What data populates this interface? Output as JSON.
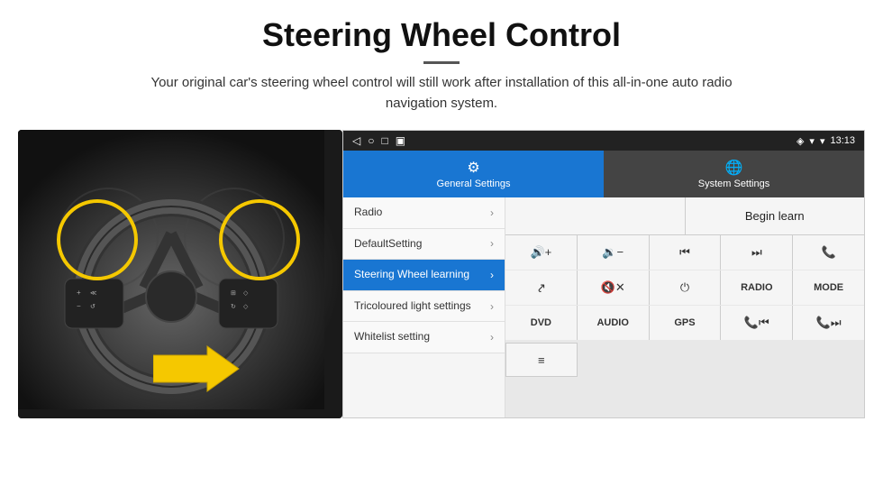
{
  "header": {
    "title": "Steering Wheel Control",
    "subtitle": "Your original car's steering wheel control will still work after installation of this all-in-one auto radio navigation system."
  },
  "status_bar": {
    "icons_left": [
      "◁",
      "○",
      "□",
      "▣"
    ],
    "signal": "▾",
    "wifi": "▾",
    "time": "13:13"
  },
  "tabs": {
    "general": {
      "label": "General Settings",
      "icon": "⚙"
    },
    "system": {
      "label": "System Settings",
      "icon": "🌐"
    }
  },
  "menu_items": [
    {
      "label": "Radio",
      "active": false
    },
    {
      "label": "DefaultSetting",
      "active": false
    },
    {
      "label": "Steering Wheel learning",
      "active": true
    },
    {
      "label": "Tricoloured light settings",
      "active": false
    },
    {
      "label": "Whitelist setting",
      "active": false
    }
  ],
  "right_panel": {
    "begin_learn": "Begin learn",
    "buttons": [
      {
        "icon": "vol_up",
        "display": "🔊+"
      },
      {
        "icon": "vol_down",
        "display": "🔉−"
      },
      {
        "icon": "prev",
        "display": "⏮"
      },
      {
        "icon": "next",
        "display": "⏭"
      },
      {
        "icon": "phone",
        "display": "📞"
      },
      {
        "icon": "hang_up",
        "display": "↩"
      },
      {
        "icon": "mute",
        "display": "🔇✕"
      },
      {
        "icon": "power",
        "display": "⏻"
      },
      {
        "icon": "radio",
        "display": "RADIO",
        "text": true
      },
      {
        "icon": "mode",
        "display": "MODE",
        "text": true
      },
      {
        "icon": "dvd",
        "display": "DVD",
        "text": true
      },
      {
        "icon": "audio",
        "display": "AUDIO",
        "text": true
      },
      {
        "icon": "gps",
        "display": "GPS",
        "text": true
      },
      {
        "icon": "phone_prev",
        "display": "📞⏮"
      },
      {
        "icon": "phone_next",
        "display": "📞⏭"
      }
    ],
    "last_row_icon": "≡"
  }
}
